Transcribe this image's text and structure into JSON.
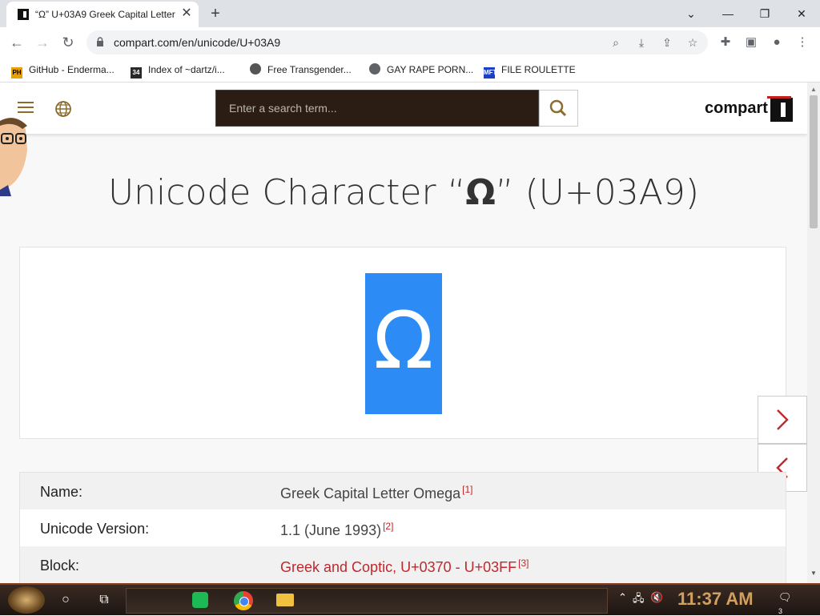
{
  "browser": {
    "tab_title": "“Ω” U+03A9 Greek Capital Letter Omega",
    "tab_close": "✕",
    "new_tab": "+",
    "url": "compart.com/en/unicode/U+03A9",
    "window_controls": {
      "minimize": "—",
      "maximize": "❐",
      "close": "✕",
      "tab_search": "⌄"
    },
    "bookmarks": [
      {
        "label": "GitHub - Enderma...",
        "icon": "ph-icon"
      },
      {
        "label": "Index of ~dartz/i...",
        "icon": "index-icon"
      },
      {
        "label": "Free Transgender...",
        "icon": "person-icon"
      },
      {
        "label": "GAY RAPE PORN...",
        "icon": "globe-icon"
      },
      {
        "label": "FILE ROULETTE",
        "icon": "mft-icon"
      }
    ]
  },
  "site": {
    "search_placeholder": "Enter a search term...",
    "logo_text": "compart"
  },
  "character": {
    "title_prefix": "Unicode Character “",
    "glyph": "Ω",
    "title_suffix": "” (U+03A9)",
    "glyph_bg_color": "#2c8bf4"
  },
  "properties": [
    {
      "name": "Name:",
      "value": "Greek Capital Letter Omega",
      "ref": "[1]"
    },
    {
      "name": "Unicode Version:",
      "value": "1.1 (June 1993)",
      "ref": "[2]"
    },
    {
      "name": "Block:",
      "value": "Greek and Coptic, U+0370 - U+03FF",
      "ref": "[3]"
    }
  ],
  "taskbar": {
    "clock": "11:37 AM",
    "notification_count": "3"
  },
  "colors": {
    "link_red": "#c0282d",
    "search_bg": "#2b1d14",
    "accent_gold": "#8a6d2e"
  }
}
